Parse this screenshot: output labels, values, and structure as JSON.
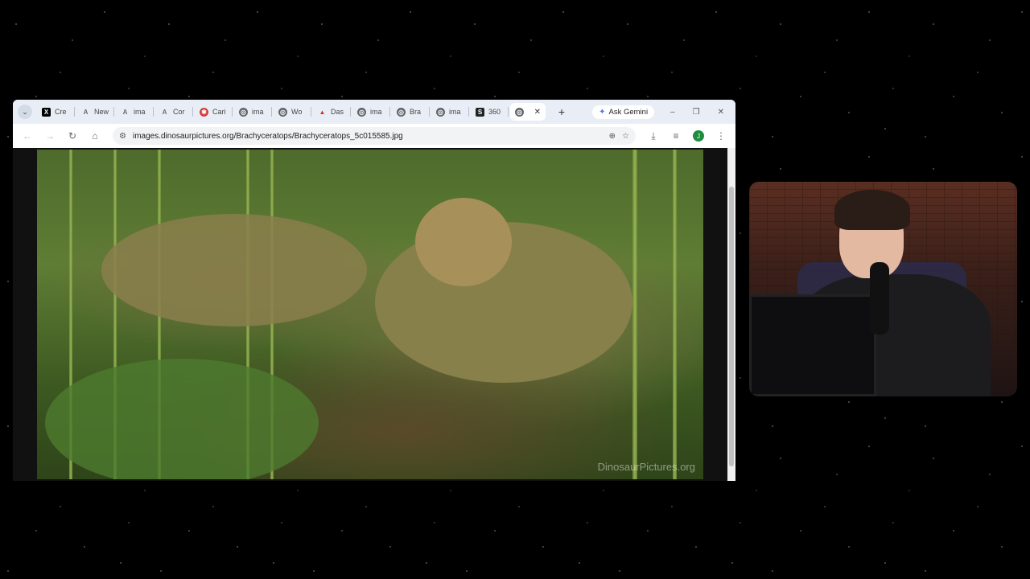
{
  "browser": {
    "tabs": [
      {
        "icon": "x-logo",
        "label": "Cre",
        "color": "#000000"
      },
      {
        "icon": "ai-logo",
        "label": "New",
        "color": "#6b6b6b"
      },
      {
        "icon": "ai-logo",
        "label": "ima",
        "color": "#6b6b6b"
      },
      {
        "icon": "ai-logo",
        "label": "Cor",
        "color": "#6b6b6b"
      },
      {
        "icon": "canva-logo",
        "label": "Cari",
        "color": "#d43b3b"
      },
      {
        "icon": "globe-icon",
        "label": "ima",
        "color": "#5f6368"
      },
      {
        "icon": "globe-icon",
        "label": "Wo",
        "color": "#5f6368"
      },
      {
        "icon": "dash-logo",
        "label": "Das",
        "color": "#d93025"
      },
      {
        "icon": "globe-icon",
        "label": "ima",
        "color": "#5f6368"
      },
      {
        "icon": "globe-icon",
        "label": "Bra",
        "color": "#5f6368"
      },
      {
        "icon": "globe-icon",
        "label": "ima",
        "color": "#5f6368"
      },
      {
        "icon": "s-logo",
        "label": "360",
        "color": "#222222"
      }
    ],
    "active_tab": {
      "icon": "globe-icon",
      "close": "✕"
    },
    "new_tab": "+",
    "gemini_label": "Ask Gemini",
    "window_controls": {
      "minimize": "–",
      "maximize": "❐",
      "close": "✕"
    },
    "url": "images.dinosaurpictures.org/Brachyceratops/Brachyceratops_5c015585.jpg"
  },
  "image": {
    "watermark": "DinosaurPictures.org",
    "colors": {
      "foliage": "#4e6b2c",
      "dino": "#7c7446",
      "ground": "#5a4a2a"
    }
  },
  "webcam": {
    "label": ""
  }
}
